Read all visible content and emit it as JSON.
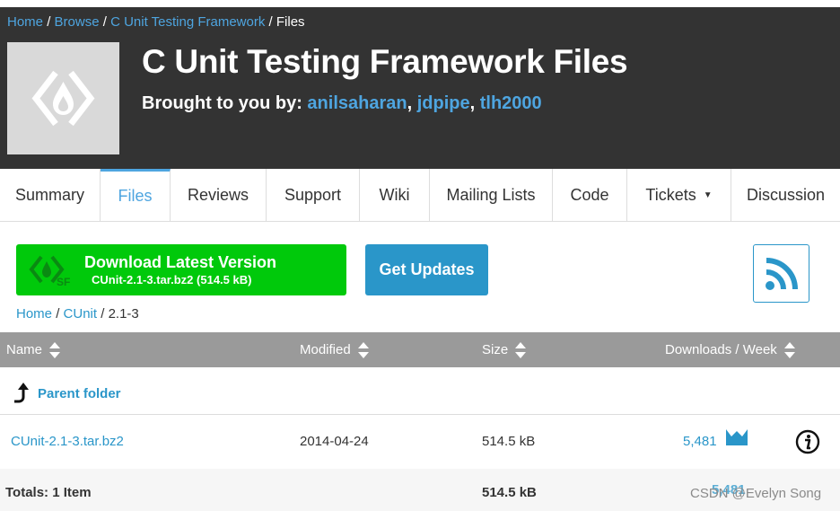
{
  "breadcrumb_top": {
    "items": [
      "Home",
      "Browse",
      "C Unit Testing Framework"
    ],
    "current": "Files",
    "separator": "/"
  },
  "project": {
    "title": "C Unit Testing Framework Files",
    "brought_prefix": "Brought to you by:",
    "authors": [
      "anilsaharan",
      "jdpipe",
      "tlh2000"
    ],
    "logo_icon": "sourceforge-diamond-icon"
  },
  "tabs": [
    {
      "label": "Summary",
      "active": false
    },
    {
      "label": "Files",
      "active": true
    },
    {
      "label": "Reviews",
      "active": false
    },
    {
      "label": "Support",
      "active": false
    },
    {
      "label": "Wiki",
      "active": false
    },
    {
      "label": "Mailing Lists",
      "active": false
    },
    {
      "label": "Code",
      "active": false
    },
    {
      "label": "Tickets",
      "active": false,
      "caret": "▼"
    },
    {
      "label": "Discussion",
      "active": false
    }
  ],
  "download": {
    "title": "Download Latest Version",
    "subtitle": "CUnit-2.1-3.tar.bz2 (514.5 kB)",
    "icon": "sf-download-icon"
  },
  "updates_label": "Get Updates",
  "rss_icon": "rss-icon",
  "breadcrumb_sub": {
    "items": [
      "Home",
      "CUnit"
    ],
    "current": "2.1-3"
  },
  "table": {
    "columns": [
      "Name",
      "Modified",
      "Size",
      "Downloads / Week"
    ],
    "parent_folder": "Parent folder",
    "rows": [
      {
        "name": "CUnit-2.1-3.tar.bz2",
        "modified": "2014-04-24",
        "size": "514.5 kB",
        "downloads": "5,481"
      }
    ],
    "totals": {
      "label": "Totals: 1 Item",
      "size": "514.5 kB",
      "downloads": "5,481"
    }
  },
  "watermark": "CSDN @Evelyn Song",
  "colors": {
    "header_bg": "#333333",
    "link": "#2a96c9",
    "download_green": "#00c90b",
    "updates_blue": "#2a96c9",
    "table_header": "#9a9a9a"
  }
}
